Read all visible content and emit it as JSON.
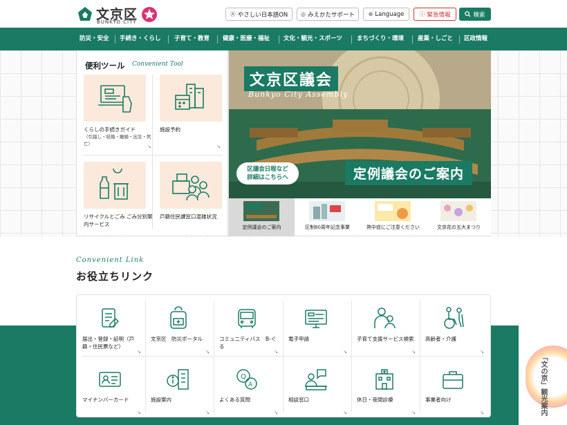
{
  "header": {
    "logo_title": "文京区",
    "logo_sub": "BUNKYO CITY",
    "buttons": {
      "easy_japanese": "やさしい日本語ON",
      "viewing_support": "みえかたサポート",
      "language": "Language",
      "emergency": "緊急情報",
      "search": "検索"
    }
  },
  "nav": {
    "items": [
      "防災・安全",
      "手続き・くらし",
      "子育て・教育",
      "健康・医療・福祉",
      "文化・観光・スポーツ",
      "まちづくり・環境",
      "産業・しごと",
      "区政情報"
    ]
  },
  "tools": {
    "title": "便利ツール",
    "subtitle": "Convenient Tool",
    "items": [
      {
        "label": "くらしの手続きガイド",
        "note": "（引越し・結婚・離婚・出生・死亡）"
      },
      {
        "label": "施設予約",
        "note": ""
      },
      {
        "label": "リサイクルとごみ ごみ分別案内サービス",
        "note": ""
      },
      {
        "label": "戸籍住民課窓口混雑状況",
        "note": ""
      }
    ]
  },
  "hero": {
    "title": "文京区議会",
    "subtitle": "Bunkyo City Assembly",
    "pill_line1": "区議会日程など",
    "pill_line2": "詳細はこちらへ",
    "caption": "定例議会のご案内"
  },
  "slides": [
    {
      "caption": "定例議会のご案内",
      "img_text": "文京区議会"
    },
    {
      "caption": "区制80周年記念事業",
      "img_text": "文京区制80周年"
    },
    {
      "caption": "熱中症にご注意ください",
      "img_text": "熱中症にご注意ください"
    },
    {
      "caption": "文京花の五大まつり",
      "img_text": "花の五大まつり"
    }
  ],
  "convenient_links": {
    "subtitle": "Convenient Link",
    "title": "お役立ちリンク",
    "items": [
      {
        "label": "届出・登録・証明（戸籍・住民票など）",
        "icon": "document-pen-icon"
      },
      {
        "label": "文京区　防災ポータル",
        "icon": "backpack-icon"
      },
      {
        "label": "コミュニティバス　B-ぐる",
        "icon": "bus-icon"
      },
      {
        "label": "電子申請",
        "icon": "monitor-form-icon"
      },
      {
        "label": "子育て支援サービス検索",
        "icon": "parent-child-icon"
      },
      {
        "label": "高齢者・介護",
        "icon": "wheelchair-icon"
      },
      {
        "label": "マイナンバーカード",
        "icon": "id-card-icon"
      },
      {
        "label": "施設案内",
        "icon": "building-info-icon"
      },
      {
        "label": "よくある質問",
        "icon": "qa-bubble-icon"
      },
      {
        "label": "相談窓口",
        "icon": "counter-icon"
      },
      {
        "label": "休日・夜間診療",
        "icon": "hospital-icon"
      },
      {
        "label": "事業者向け",
        "icon": "briefcase-icon"
      }
    ]
  },
  "tourism": {
    "label": "「文の京」観光案内"
  },
  "colors": {
    "brand_green": "#1a7a63",
    "emergency_red": "#c73636",
    "peach": "#fbeadc"
  }
}
